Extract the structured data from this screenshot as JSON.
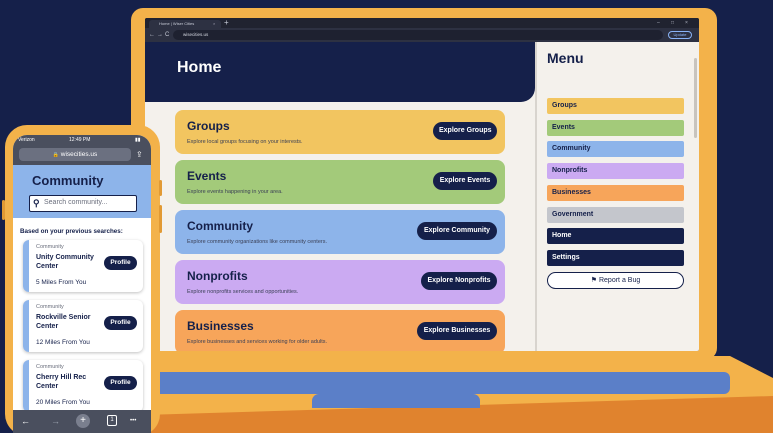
{
  "browser": {
    "tab_title": "Home | Wiser Cities",
    "tab_close": "×",
    "new_tab": "+",
    "back_icon": "←",
    "forward_icon": "→",
    "reload_icon": "C",
    "url": "wisecities.us",
    "update_label": "Update",
    "win_min": "–",
    "win_max": "□",
    "win_close": "×"
  },
  "home": {
    "title": "Home",
    "cards": [
      {
        "title": "Groups",
        "desc": "Explore local groups focusing on your interests.",
        "button": "Explore Groups",
        "color": "#f2c560"
      },
      {
        "title": "Events",
        "desc": "Explore events happening in your area.",
        "button": "Explore Events",
        "color": "#a3ca7a"
      },
      {
        "title": "Community",
        "desc": "Explore community organizations like community centers.",
        "button": "Explore Community",
        "color": "#8db4ea"
      },
      {
        "title": "Nonprofits",
        "desc": "Explore nonprofits services and opportunities.",
        "button": "Explore Nonprofits",
        "color": "#cbaaf2"
      },
      {
        "title": "Businesses",
        "desc": "Explore businesses and services working for older adults.",
        "button": "Explore Businesses",
        "color": "#f7a55a"
      }
    ]
  },
  "menu": {
    "title": "Menu",
    "items": [
      {
        "label": "Groups",
        "color": "#f2c560"
      },
      {
        "label": "Events",
        "color": "#a3ca7a"
      },
      {
        "label": "Community",
        "color": "#8db4ea"
      },
      {
        "label": "Nonprofits",
        "color": "#cbaaf2"
      },
      {
        "label": "Businesses",
        "color": "#f7a55a"
      },
      {
        "label": "Government",
        "color": "#c4c6cc"
      },
      {
        "label": "Home",
        "color": "#15204a"
      },
      {
        "label": "Settings",
        "color": "#15204a"
      }
    ],
    "report_bug": "Report a Bug",
    "report_icon": "⚑"
  },
  "phone": {
    "carrier": "Verizon",
    "time": "12:49 PM",
    "url": "wisecities.us",
    "lock_icon": "🔒",
    "share_icon": "⇪",
    "title": "Community",
    "search_icon": "⚲",
    "search_placeholder": "Search community...",
    "based_on": "Based on your previous searches:",
    "cards": [
      {
        "category": "Community",
        "name": "Unity Community Center",
        "distance": "5 Miles From You",
        "button": "Profile"
      },
      {
        "category": "Community",
        "name": "Rockville Senior Center",
        "distance": "12 Miles From You",
        "button": "Profile"
      },
      {
        "category": "Community",
        "name": "Cherry Hill Rec Center",
        "distance": "20 Miles From You",
        "button": "Profile"
      }
    ],
    "nav": {
      "back": "←",
      "forward": "→",
      "plus": "+",
      "tabs": "1",
      "more": "•••"
    }
  },
  "colors": {
    "background": "#15204a",
    "laptop": "#f3b24a",
    "deck_blue": "#5b7fc8",
    "navy": "#15204a"
  }
}
